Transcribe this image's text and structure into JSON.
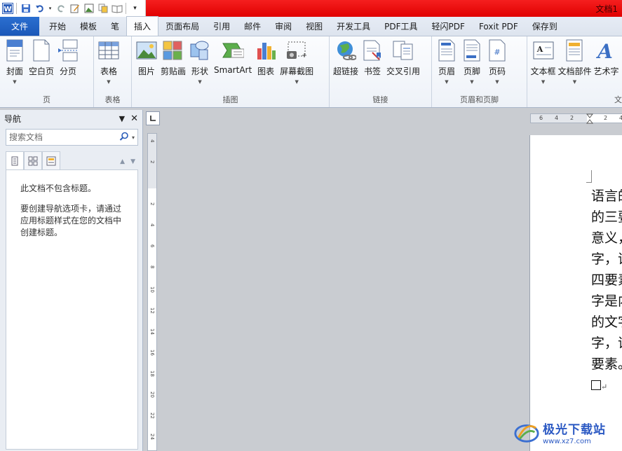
{
  "title_bar": {
    "doc_title": "文档1"
  },
  "tabs": [
    {
      "label": "文件"
    },
    {
      "label": "开始"
    },
    {
      "label": "模板"
    },
    {
      "label": "笔"
    },
    {
      "label": "插入"
    },
    {
      "label": "页面布局"
    },
    {
      "label": "引用"
    },
    {
      "label": "邮件"
    },
    {
      "label": "审阅"
    },
    {
      "label": "视图"
    },
    {
      "label": "开发工具"
    },
    {
      "label": "PDF工具"
    },
    {
      "label": "轻闪PDF"
    },
    {
      "label": "Foxit PDF"
    },
    {
      "label": "保存到"
    }
  ],
  "ribbon": {
    "groups": [
      {
        "name": "页",
        "buttons": [
          "封面",
          "空白页",
          "分页"
        ]
      },
      {
        "name": "表格",
        "buttons": [
          "表格"
        ]
      },
      {
        "name": "插图",
        "buttons": [
          "图片",
          "剪贴画",
          "形状",
          "SmartArt",
          "图表",
          "屏幕截图"
        ]
      },
      {
        "name": "链接",
        "buttons": [
          "超链接",
          "书签",
          "交叉引用"
        ]
      },
      {
        "name": "页眉和页脚",
        "buttons": [
          "页眉",
          "页脚",
          "页码"
        ]
      },
      {
        "name": "文",
        "buttons": [
          "文本框",
          "文档部件",
          "艺术字"
        ]
      }
    ]
  },
  "nav_pane": {
    "title": "导航",
    "search_placeholder": "搜索文档",
    "message1": "此文档不包含标题。",
    "message2": "要创建导航选项卡，请通过应用标题样式在您的文档中创建标题。"
  },
  "hruler_ticks": [
    "6",
    "4",
    "2",
    "2",
    "4"
  ],
  "vruler_ticks": [
    "4",
    "2",
    "2",
    "4",
    "6",
    "8",
    "10",
    "12",
    "14",
    "16",
    "18",
    "20",
    "22",
    "24"
  ],
  "document": {
    "lines": [
      "语言的",
      "的三要",
      "意义，",
      "字，语",
      "四要素",
      "字是内",
      "的文字",
      "字，语",
      "要素。"
    ],
    "para_mark": "↵"
  },
  "watermark": {
    "name": "极光下载站",
    "url": "www.xz7.com"
  },
  "colors": {
    "title_red": "#e00000",
    "file_tab_blue": "#1b58b8",
    "watermark_blue": "#2b59c3"
  }
}
